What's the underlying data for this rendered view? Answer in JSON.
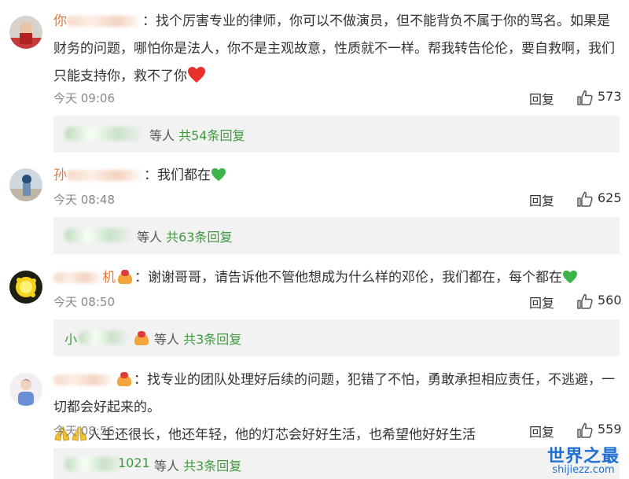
{
  "comments": [
    {
      "user_visible": "你",
      "text": "找个厉害专业的律师，你可以不做演员，但不能背负不属于你的骂名。如果是财务的问题，哪怕你是法人，你不是主观故意，性质就不一样。帮我转告伦伦，要自救啊，我们只能支持你，救不了你",
      "emoji": "red-heart",
      "time": "今天 09:06",
      "reply_label": "回复",
      "likes": "573",
      "subreplies": {
        "suffix": "等人",
        "count_text": "共54条回复"
      }
    },
    {
      "user_visible": "孙",
      "text": "我们都在",
      "emoji": "green-heart",
      "time": "今天 08:48",
      "reply_label": "回复",
      "likes": "625",
      "subreplies": {
        "suffix": "等人",
        "count_text": "共63条回复"
      }
    },
    {
      "user_visible": "机",
      "text": "谢谢哥哥，请告诉他不管他想成为什么样的邓伦，我们都在，每个都在",
      "emoji": "green-heart",
      "time": "今天 08:50",
      "reply_label": "回复",
      "likes": "560",
      "subreplies": {
        "user_visible": "小",
        "suffix": "等人",
        "count_text": "共3条回复"
      }
    },
    {
      "user_visible": "",
      "text_line1": "找专业的团队处理好后续的问题，犯错了不怕，勇敢承担相应责任，不逃避，一切都会好起来的。",
      "text_line2": "人生还很长，他还年轻，他的灯芯会好好生活，也希望他好好生活",
      "time": "今天 08:56",
      "reply_label": "回复",
      "likes": "559",
      "subreplies": {
        "user_visible": "1021",
        "suffix": "等人",
        "count_text": "共3条回复"
      }
    }
  ],
  "watermark": {
    "main": "世界之最",
    "sub": "shijiezz.com"
  },
  "colors": {
    "username": "#e2793a",
    "reply_count": "#3c9a3c",
    "subreply_bg": "#f2f2f2",
    "watermark": "#1f6fd1"
  }
}
